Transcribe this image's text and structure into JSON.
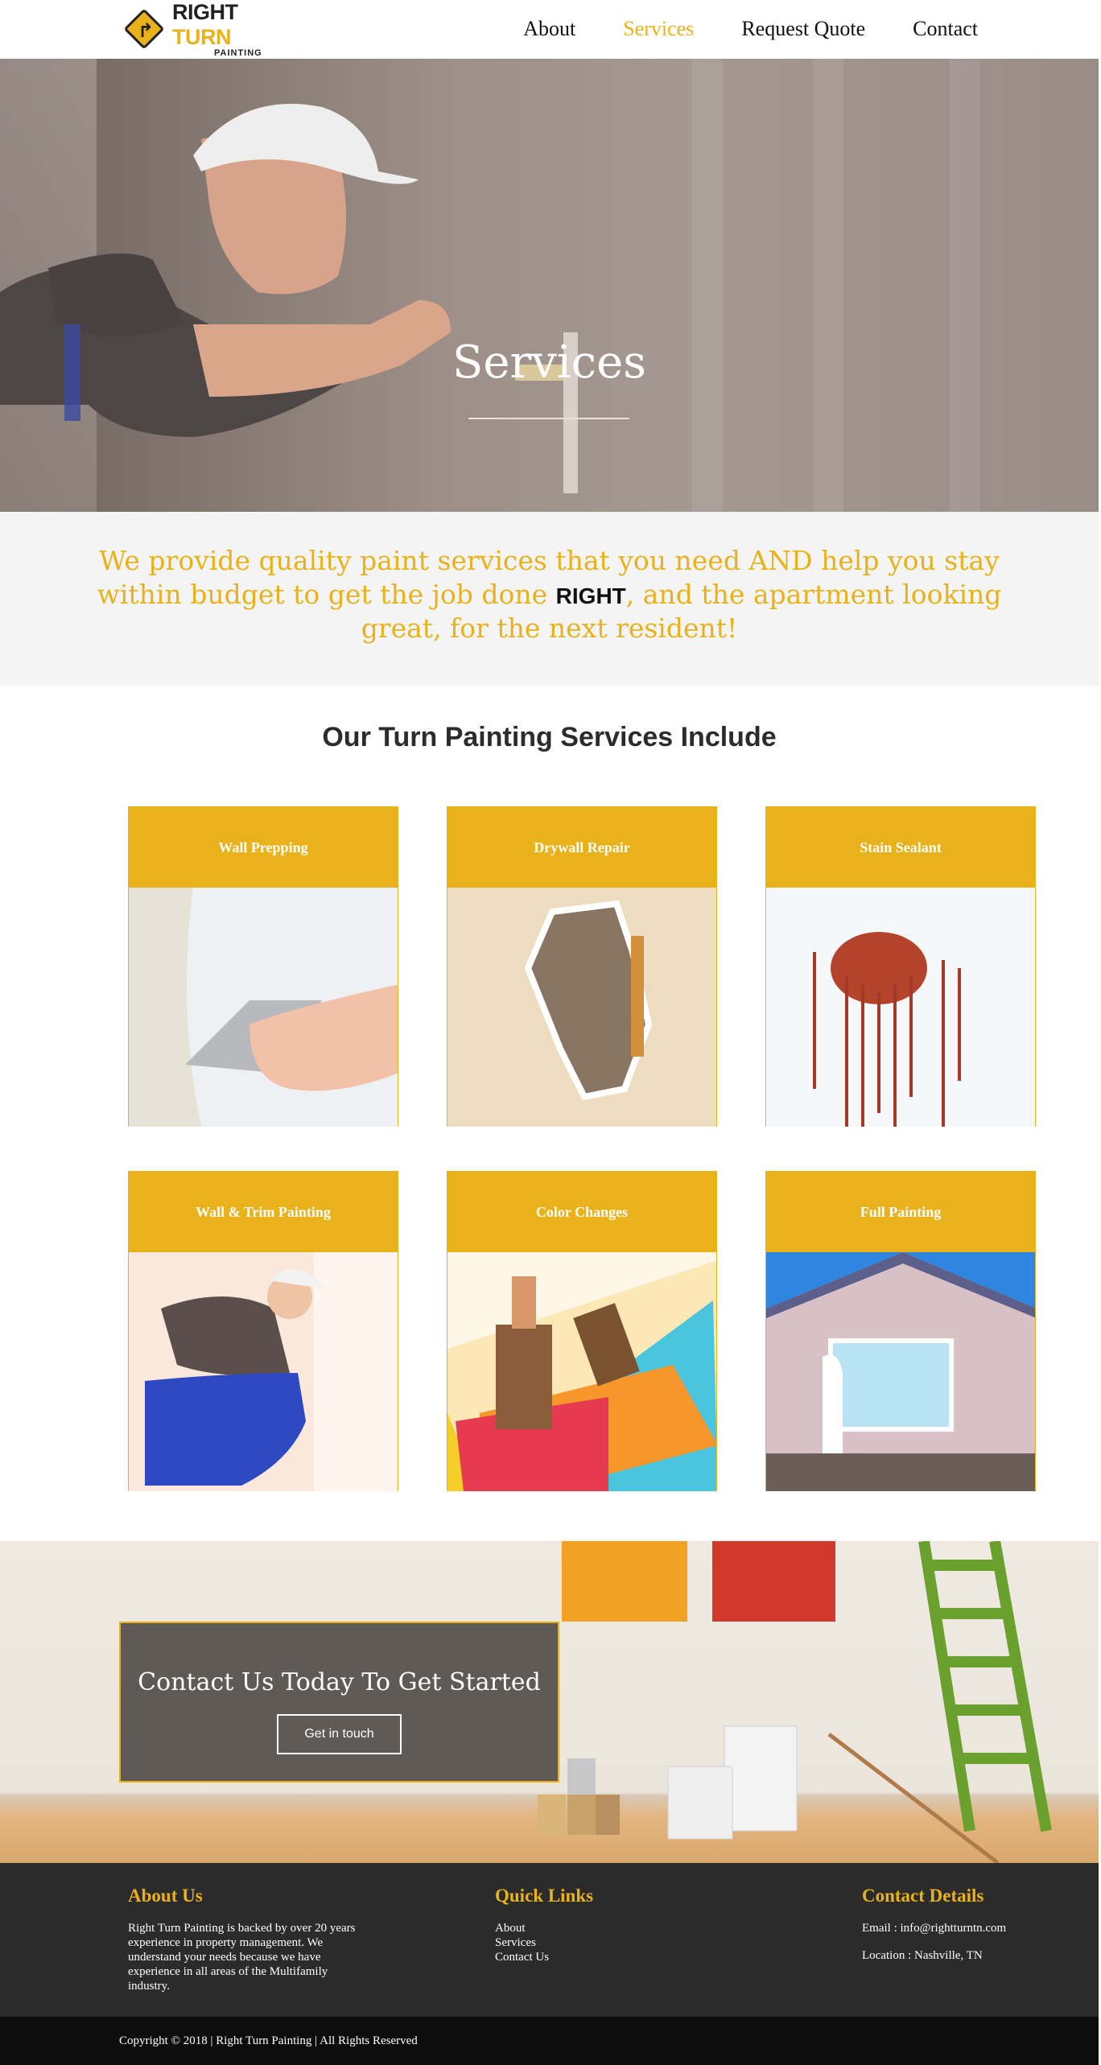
{
  "brand": {
    "line1": "RIGHT",
    "line2": "TURN",
    "line3": "PAINTING",
    "accent": "#e9b21b"
  },
  "nav": [
    {
      "label": "About"
    },
    {
      "label": "Services",
      "active": true
    },
    {
      "label": "Request Quote"
    },
    {
      "label": "Contact"
    }
  ],
  "hero": {
    "title": "Services"
  },
  "intro": {
    "before": "We provide quality paint services that you need AND help you stay within budget to get the job done ",
    "strong": "RIGHT",
    "after": ", and the apartment looking great, for the next resident!"
  },
  "services": {
    "title": "Our Turn Painting Services Include",
    "items": [
      {
        "label": "Wall Prepping",
        "icon": "trowel-on-wall-image"
      },
      {
        "label": "Drywall Repair",
        "icon": "hole-in-wall-image"
      },
      {
        "label": "Stain Sealant",
        "icon": "red-stain-image"
      },
      {
        "label": "Wall & Trim Painting",
        "icon": "painter-kneeling-image"
      },
      {
        "label": "Color Changes",
        "icon": "brushes-color-fan-image"
      },
      {
        "label": "Full Painting",
        "icon": "house-painter-image"
      }
    ]
  },
  "cta": {
    "title": "Contact Us Today To Get Started",
    "button": "Get in touch"
  },
  "footer": {
    "about": {
      "title": "About Us",
      "text": "Right Turn Painting is backed by over 20 years experience in property management. We understand your needs because we have experience in all areas of the Multifamily industry."
    },
    "links": {
      "title": "Quick Links",
      "items": [
        "About",
        "Services",
        "Contact Us"
      ]
    },
    "contact": {
      "title": "Contact Details",
      "email": "Email : info@rightturntn.com",
      "location": "Location : Nashville, TN"
    },
    "copyright": "Copyright © 2018 | Right Turn Painting | All Rights Reserved"
  }
}
